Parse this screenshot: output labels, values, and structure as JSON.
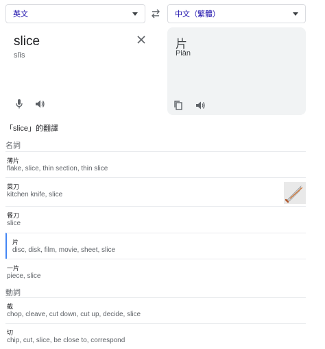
{
  "languages": {
    "source": "英文",
    "target": "中文（繁體）"
  },
  "source_panel": {
    "word": "slice",
    "romanization": "slīs"
  },
  "target_panel": {
    "word": "片",
    "romanization": "Piàn"
  },
  "dictionary": {
    "title": "「slice」的翻譯",
    "sections": [
      {
        "pos": "名詞",
        "entries": [
          {
            "word": "薄片",
            "synonyms": "flake, slice, thin section, thin slice"
          },
          {
            "word": "菜刀",
            "synonyms": "kitchen knife, slice"
          },
          {
            "word": "餐刀",
            "synonyms": "slice"
          },
          {
            "word": "片",
            "synonyms": "disc, disk, film, movie, sheet, slice"
          },
          {
            "word": "一片",
            "synonyms": "piece, slice"
          }
        ]
      },
      {
        "pos": "動詞",
        "entries": [
          {
            "word": "截",
            "synonyms": "chop, cleave, cut down, cut up, decide, slice"
          },
          {
            "word": "切",
            "synonyms": "chip, cut, slice, be close to, correspond"
          }
        ]
      }
    ]
  },
  "icons": {
    "swap": "swap-arrows-icon",
    "clear": "close-icon",
    "mic": "microphone-icon",
    "speaker": "speaker-icon",
    "copy": "copy-icon"
  },
  "colors": {
    "language_link": "#1a0dab",
    "icon": "#5f6368",
    "selected_bar": "#4285f4",
    "target_bg": "#f1f3f4"
  }
}
